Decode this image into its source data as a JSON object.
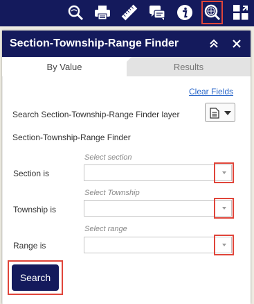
{
  "toolbar": {
    "tools": [
      {
        "icon": "zoom-magnifier-icon"
      },
      {
        "icon": "print-icon"
      },
      {
        "icon": "measure-ruler-icon"
      },
      {
        "icon": "chat-bubbles-icon"
      },
      {
        "icon": "info-icon"
      },
      {
        "icon": "query-finder-icon",
        "active": true
      },
      {
        "icon": "widget-grid-icon"
      }
    ]
  },
  "panel": {
    "title": "Section-Township-Range Finder",
    "tabs": [
      {
        "label": "By Value",
        "active": true
      },
      {
        "label": "Results",
        "active": false
      }
    ],
    "clear_fields": "Clear Fields",
    "search_layer_label": "Search Section-Township-Range Finder layer",
    "finder_label": "Section-Township-Range Finder",
    "fields": [
      {
        "hint": "Select section",
        "label": "Section is",
        "value": ""
      },
      {
        "hint": "Select Township",
        "label": "Township is",
        "value": ""
      },
      {
        "hint": "Select range",
        "label": "Range is",
        "value": ""
      }
    ],
    "search_button": "Search"
  },
  "colors": {
    "header": "#141a5c",
    "highlight": "#e0453a",
    "link": "#2866c9"
  }
}
